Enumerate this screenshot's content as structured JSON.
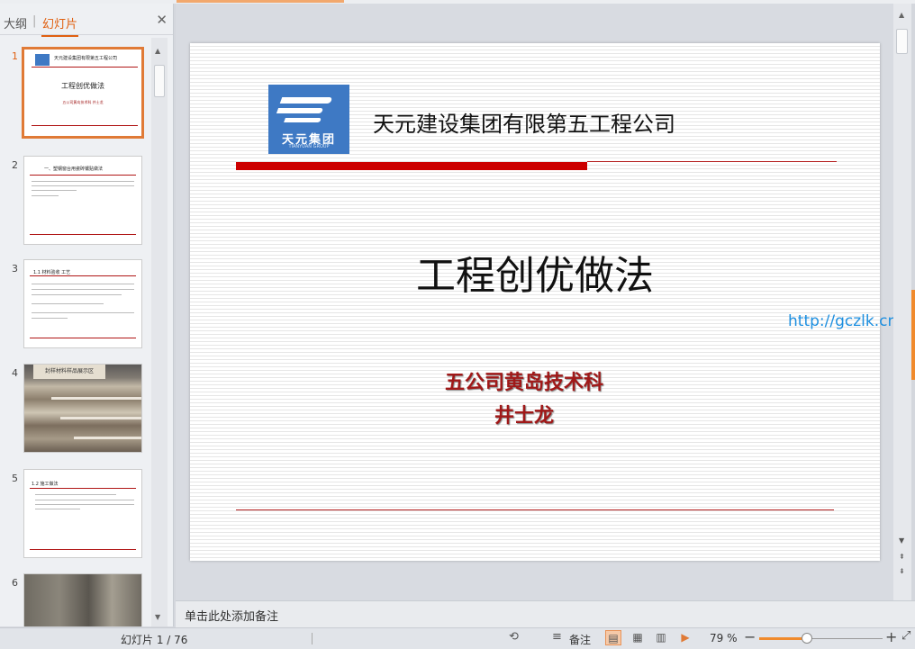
{
  "panel": {
    "tab_outline": "大纲",
    "tab_separator": "|",
    "tab_slides": "幻灯片",
    "close_icon": "✕",
    "thumbnails": [
      {
        "num": "1",
        "selected": true,
        "title": "天元建设集团有限第五工程公司",
        "heading": "工程创优做法",
        "sub": "五公司黄岛技术科 井士龙"
      },
      {
        "num": "2",
        "heading": "一、塑钢窗台用瓷砖镶贴做法"
      },
      {
        "num": "3",
        "heading": "1.1 材料验收 工艺"
      },
      {
        "num": "4",
        "photo_text": "封样材料样品展示区"
      },
      {
        "num": "5",
        "heading": "1.2 施工做法"
      },
      {
        "num": "6"
      }
    ]
  },
  "slide": {
    "company": "天元建设集团有限第五工程公司",
    "logo_text": "天元集团",
    "logo_sub": "TIANYUAN GROUP",
    "title": "工程创优做法",
    "dept": "五公司黄岛技术科",
    "author": "井士龙"
  },
  "watermark": "http://gczlk.cn",
  "notes_placeholder": "单击此处添加备注",
  "status": {
    "slide_counter": "幻灯片 1 / 76",
    "notes_label": "备注",
    "zoom": "79 %",
    "zoom_fraction": 0.39
  },
  "colors": {
    "accent": "#e06010",
    "slide_red": "#cc0000",
    "subtitle_red": "#a01818",
    "logo_blue": "#3e79c4",
    "watermark_blue": "#1d8fe0"
  }
}
